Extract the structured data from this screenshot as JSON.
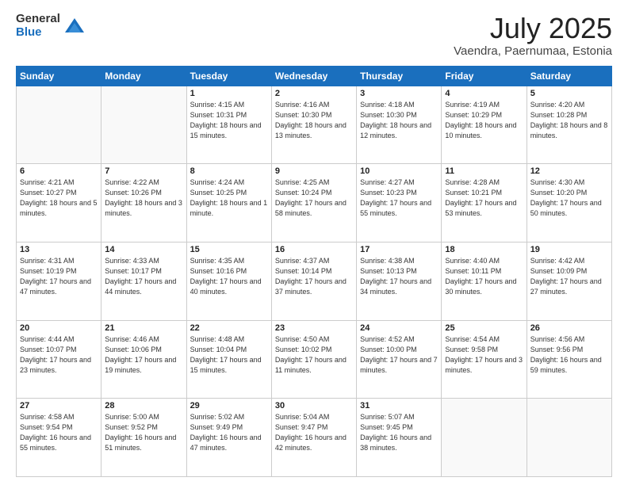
{
  "header": {
    "logo_general": "General",
    "logo_blue": "Blue",
    "month_title": "July 2025",
    "location": "Vaendra, Paernumaa, Estonia"
  },
  "days_of_week": [
    "Sunday",
    "Monday",
    "Tuesday",
    "Wednesday",
    "Thursday",
    "Friday",
    "Saturday"
  ],
  "weeks": [
    [
      {
        "num": "",
        "info": ""
      },
      {
        "num": "",
        "info": ""
      },
      {
        "num": "1",
        "info": "Sunrise: 4:15 AM\nSunset: 10:31 PM\nDaylight: 18 hours\nand 15 minutes."
      },
      {
        "num": "2",
        "info": "Sunrise: 4:16 AM\nSunset: 10:30 PM\nDaylight: 18 hours\nand 13 minutes."
      },
      {
        "num": "3",
        "info": "Sunrise: 4:18 AM\nSunset: 10:30 PM\nDaylight: 18 hours\nand 12 minutes."
      },
      {
        "num": "4",
        "info": "Sunrise: 4:19 AM\nSunset: 10:29 PM\nDaylight: 18 hours\nand 10 minutes."
      },
      {
        "num": "5",
        "info": "Sunrise: 4:20 AM\nSunset: 10:28 PM\nDaylight: 18 hours\nand 8 minutes."
      }
    ],
    [
      {
        "num": "6",
        "info": "Sunrise: 4:21 AM\nSunset: 10:27 PM\nDaylight: 18 hours\nand 5 minutes."
      },
      {
        "num": "7",
        "info": "Sunrise: 4:22 AM\nSunset: 10:26 PM\nDaylight: 18 hours\nand 3 minutes."
      },
      {
        "num": "8",
        "info": "Sunrise: 4:24 AM\nSunset: 10:25 PM\nDaylight: 18 hours\nand 1 minute."
      },
      {
        "num": "9",
        "info": "Sunrise: 4:25 AM\nSunset: 10:24 PM\nDaylight: 17 hours\nand 58 minutes."
      },
      {
        "num": "10",
        "info": "Sunrise: 4:27 AM\nSunset: 10:23 PM\nDaylight: 17 hours\nand 55 minutes."
      },
      {
        "num": "11",
        "info": "Sunrise: 4:28 AM\nSunset: 10:21 PM\nDaylight: 17 hours\nand 53 minutes."
      },
      {
        "num": "12",
        "info": "Sunrise: 4:30 AM\nSunset: 10:20 PM\nDaylight: 17 hours\nand 50 minutes."
      }
    ],
    [
      {
        "num": "13",
        "info": "Sunrise: 4:31 AM\nSunset: 10:19 PM\nDaylight: 17 hours\nand 47 minutes."
      },
      {
        "num": "14",
        "info": "Sunrise: 4:33 AM\nSunset: 10:17 PM\nDaylight: 17 hours\nand 44 minutes."
      },
      {
        "num": "15",
        "info": "Sunrise: 4:35 AM\nSunset: 10:16 PM\nDaylight: 17 hours\nand 40 minutes."
      },
      {
        "num": "16",
        "info": "Sunrise: 4:37 AM\nSunset: 10:14 PM\nDaylight: 17 hours\nand 37 minutes."
      },
      {
        "num": "17",
        "info": "Sunrise: 4:38 AM\nSunset: 10:13 PM\nDaylight: 17 hours\nand 34 minutes."
      },
      {
        "num": "18",
        "info": "Sunrise: 4:40 AM\nSunset: 10:11 PM\nDaylight: 17 hours\nand 30 minutes."
      },
      {
        "num": "19",
        "info": "Sunrise: 4:42 AM\nSunset: 10:09 PM\nDaylight: 17 hours\nand 27 minutes."
      }
    ],
    [
      {
        "num": "20",
        "info": "Sunrise: 4:44 AM\nSunset: 10:07 PM\nDaylight: 17 hours\nand 23 minutes."
      },
      {
        "num": "21",
        "info": "Sunrise: 4:46 AM\nSunset: 10:06 PM\nDaylight: 17 hours\nand 19 minutes."
      },
      {
        "num": "22",
        "info": "Sunrise: 4:48 AM\nSunset: 10:04 PM\nDaylight: 17 hours\nand 15 minutes."
      },
      {
        "num": "23",
        "info": "Sunrise: 4:50 AM\nSunset: 10:02 PM\nDaylight: 17 hours\nand 11 minutes."
      },
      {
        "num": "24",
        "info": "Sunrise: 4:52 AM\nSunset: 10:00 PM\nDaylight: 17 hours\nand 7 minutes."
      },
      {
        "num": "25",
        "info": "Sunrise: 4:54 AM\nSunset: 9:58 PM\nDaylight: 17 hours\nand 3 minutes."
      },
      {
        "num": "26",
        "info": "Sunrise: 4:56 AM\nSunset: 9:56 PM\nDaylight: 16 hours\nand 59 minutes."
      }
    ],
    [
      {
        "num": "27",
        "info": "Sunrise: 4:58 AM\nSunset: 9:54 PM\nDaylight: 16 hours\nand 55 minutes."
      },
      {
        "num": "28",
        "info": "Sunrise: 5:00 AM\nSunset: 9:52 PM\nDaylight: 16 hours\nand 51 minutes."
      },
      {
        "num": "29",
        "info": "Sunrise: 5:02 AM\nSunset: 9:49 PM\nDaylight: 16 hours\nand 47 minutes."
      },
      {
        "num": "30",
        "info": "Sunrise: 5:04 AM\nSunset: 9:47 PM\nDaylight: 16 hours\nand 42 minutes."
      },
      {
        "num": "31",
        "info": "Sunrise: 5:07 AM\nSunset: 9:45 PM\nDaylight: 16 hours\nand 38 minutes."
      },
      {
        "num": "",
        "info": ""
      },
      {
        "num": "",
        "info": ""
      }
    ]
  ]
}
